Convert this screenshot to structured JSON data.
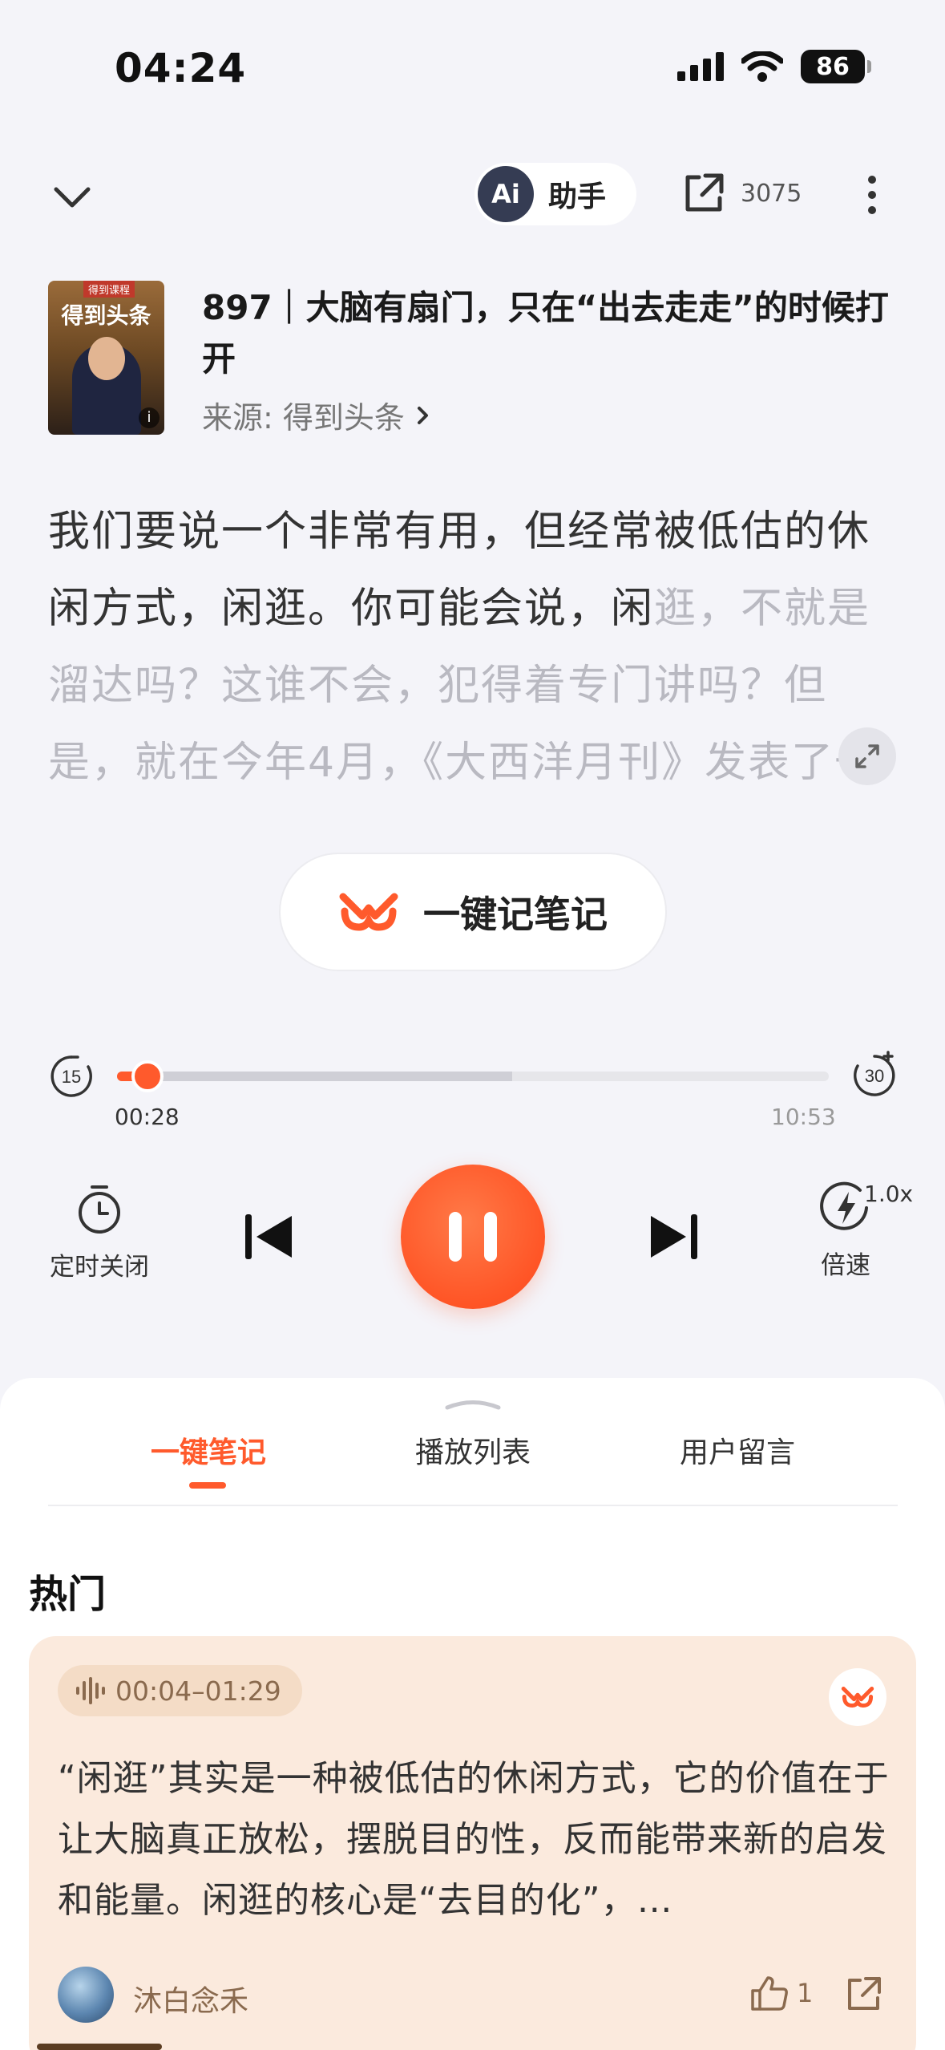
{
  "status_bar": {
    "time": "04:24",
    "battery": "86"
  },
  "nav": {
    "ai_badge": "Ai",
    "ai_label": "助手",
    "share_count": "3075"
  },
  "episode": {
    "cover_tag": "得到课程",
    "cover_title": "得到头条",
    "title": "897｜大脑有扇门，只在“出去走走”的时候打开",
    "source_label": "来源: 得到头条"
  },
  "transcript": {
    "read": "我们要说一个非常有用，但经常被低估的休闲方式，闲逛。你可能会说，闲",
    "unread": "逛，不就是溜达吗？这谁不会，犯得着专门讲吗？但是，就在今年4月，《大西洋月刊》发表了一"
  },
  "note_button": {
    "label": "一键记笔记"
  },
  "player": {
    "skip_back": "15",
    "skip_forward": "30",
    "current_time": "00:28",
    "total_time": "10:53",
    "progress_fraction": 0.043,
    "buffered_fraction": 0.555,
    "timer_label": "定时关闭",
    "speed_label": "倍速",
    "speed_value": "1.0x",
    "state": "playing"
  },
  "tabs": [
    {
      "label": "一键笔记",
      "active": true
    },
    {
      "label": "播放列表",
      "active": false
    },
    {
      "label": "用户留言",
      "active": false
    }
  ],
  "hot": {
    "title": "热门",
    "card": {
      "time_range": "00:04–01:29",
      "text": "“闲逛”其实是一种被低估的休闲方式，它的价值在于让大脑真正放松，摆脱目的性，反而能带来新的启发和能量。闲逛的核心是“去目的化”，…",
      "author": "沐白念禾",
      "likes": "1"
    }
  },
  "colors": {
    "accent": "#ff5a2c",
    "card_bg": "#fbeadd",
    "page_bg": "#f4f4f9"
  }
}
